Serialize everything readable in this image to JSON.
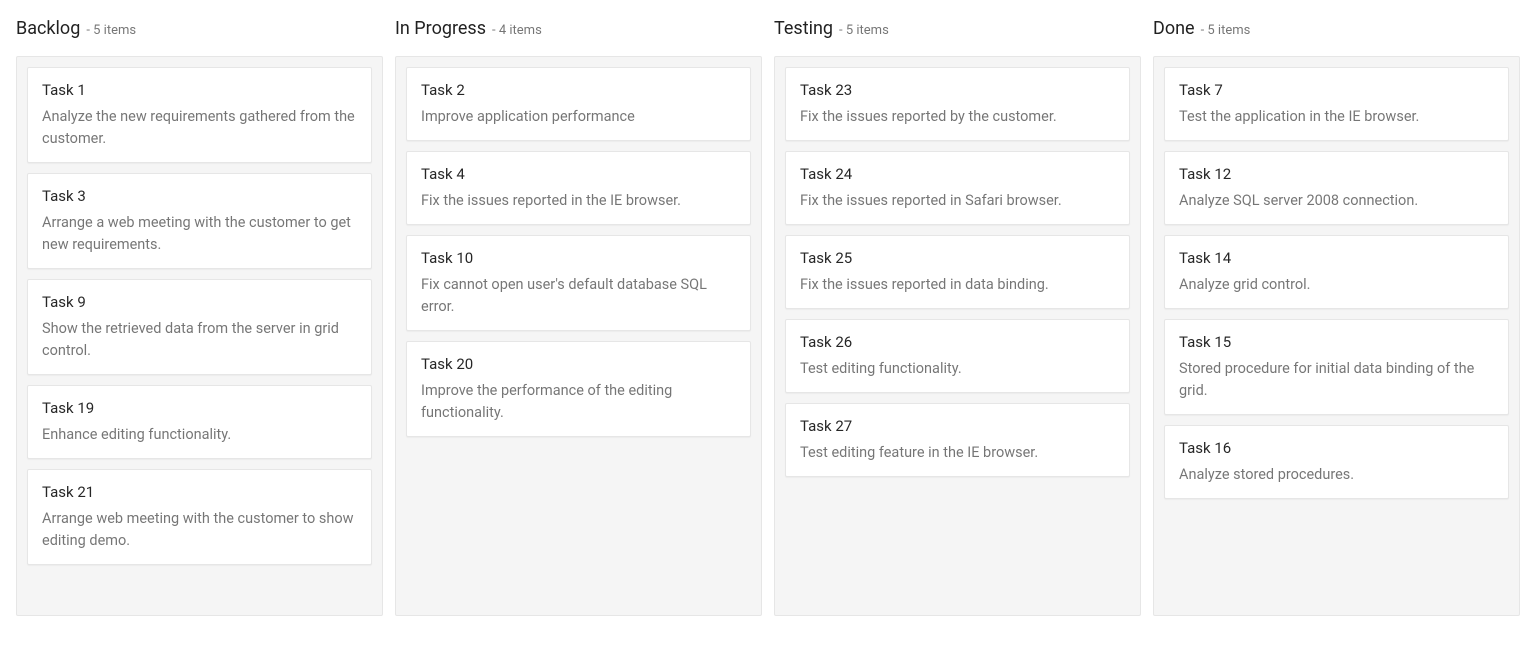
{
  "columns": [
    {
      "title": "Backlog",
      "count_text": "- 5 items",
      "cards": [
        {
          "title": "Task 1",
          "desc": "Analyze the new requirements gathered from the customer."
        },
        {
          "title": "Task 3",
          "desc": "Arrange a web meeting with the customer to get new requirements."
        },
        {
          "title": "Task 9",
          "desc": "Show the retrieved data from the server in grid control."
        },
        {
          "title": "Task 19",
          "desc": "Enhance editing functionality."
        },
        {
          "title": "Task 21",
          "desc": "Arrange web meeting with the customer to show editing demo."
        }
      ]
    },
    {
      "title": "In Progress",
      "count_text": "- 4 items",
      "cards": [
        {
          "title": "Task 2",
          "desc": "Improve application performance"
        },
        {
          "title": "Task 4",
          "desc": "Fix the issues reported in the IE browser."
        },
        {
          "title": "Task 10",
          "desc": "Fix cannot open user's default database SQL error."
        },
        {
          "title": "Task 20",
          "desc": "Improve the performance of the editing functionality."
        }
      ]
    },
    {
      "title": "Testing",
      "count_text": "- 5 items",
      "cards": [
        {
          "title": "Task 23",
          "desc": "Fix the issues reported by the customer."
        },
        {
          "title": "Task 24",
          "desc": "Fix the issues reported in Safari browser."
        },
        {
          "title": "Task 25",
          "desc": "Fix the issues reported in data binding."
        },
        {
          "title": "Task 26",
          "desc": "Test editing functionality."
        },
        {
          "title": "Task 27",
          "desc": "Test editing feature in the IE browser."
        }
      ]
    },
    {
      "title": "Done",
      "count_text": "- 5 items",
      "cards": [
        {
          "title": "Task 7",
          "desc": "Test the application in the IE browser."
        },
        {
          "title": "Task 12",
          "desc": "Analyze SQL server 2008 connection."
        },
        {
          "title": "Task 14",
          "desc": "Analyze grid control."
        },
        {
          "title": "Task 15",
          "desc": "Stored procedure for initial data binding of the grid."
        },
        {
          "title": "Task 16",
          "desc": "Analyze stored procedures."
        }
      ]
    }
  ]
}
